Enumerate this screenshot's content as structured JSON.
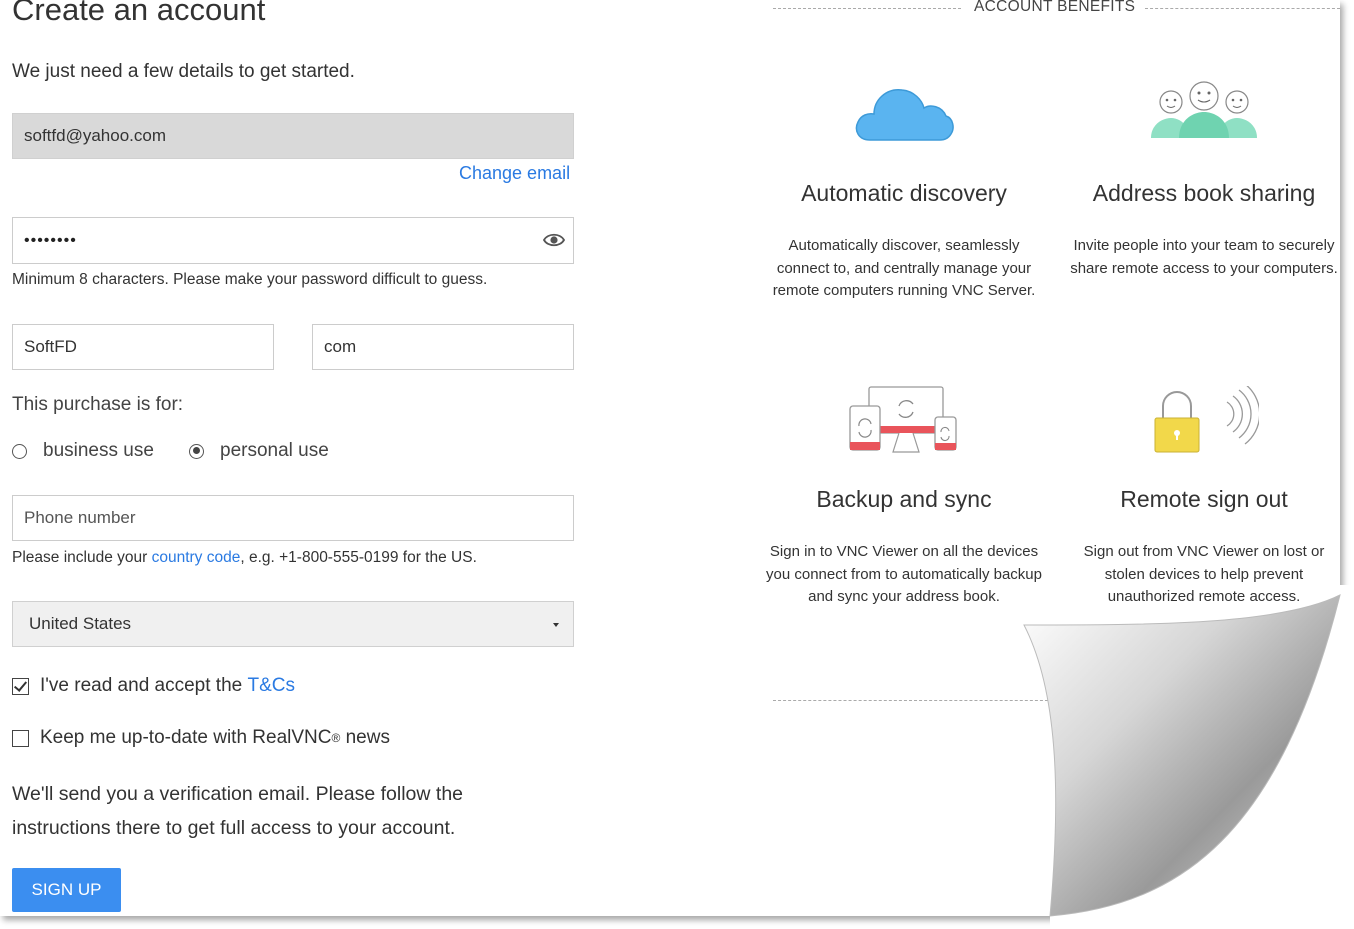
{
  "form": {
    "title": "Create an account",
    "subtitle": "We just need a few details to get started.",
    "email_value": "softfd@yahoo.com",
    "change_email_label": "Change email",
    "password_value": "••••••••",
    "password_help": "Minimum 8 characters. Please make your password difficult to guess.",
    "first_name_value": "SoftFD",
    "last_name_value": "com",
    "purchase_label": "This purchase is for:",
    "purchase_options": [
      {
        "label": "business use",
        "selected": false
      },
      {
        "label": "personal use",
        "selected": true
      }
    ],
    "phone_placeholder": "Phone number",
    "phone_help_prefix": "Please include your ",
    "phone_help_link": "country code",
    "phone_help_suffix": ", e.g. +1-800-555-0199 for the US.",
    "country_value": "United States",
    "terms_prefix": "I've read and accept the ",
    "terms_link": "T&Cs",
    "terms_checked": true,
    "news_label": "Keep me up-to-date with RealVNC",
    "news_sup": "®",
    "news_suffix": " news",
    "news_checked": false,
    "notice": "We'll send you a verification email. Please follow the instructions there to get full access to your account.",
    "signup_label": "SIGN UP"
  },
  "benefits": {
    "header": "ACCOUNT BENEFITS",
    "items": [
      {
        "title": "Automatic discovery",
        "text": "Automatically discover, seamlessly connect to, and centrally manage your remote computers running VNC Server.",
        "icon": "cloud-icon"
      },
      {
        "title": "Address book sharing",
        "text": "Invite people into your team to securely share remote access to your computers.",
        "icon": "people-icon"
      },
      {
        "title": "Backup and sync",
        "text": "Sign in to VNC Viewer on all the devices you connect from to automatically backup and sync your address book.",
        "icon": "devices-sync-icon"
      },
      {
        "title": "Remote sign out",
        "text": "Sign out from VNC Viewer on lost or stolen devices to help prevent unauthorized remote access.",
        "icon": "padlock-signal-icon"
      }
    ]
  },
  "colors": {
    "accent": "#3b8ef0",
    "link": "#2a7ae2",
    "cloud": "#5ab4f0",
    "people": "#8fe0c4",
    "devices_red": "#e9545b",
    "lock_yellow": "#f2d84a"
  }
}
